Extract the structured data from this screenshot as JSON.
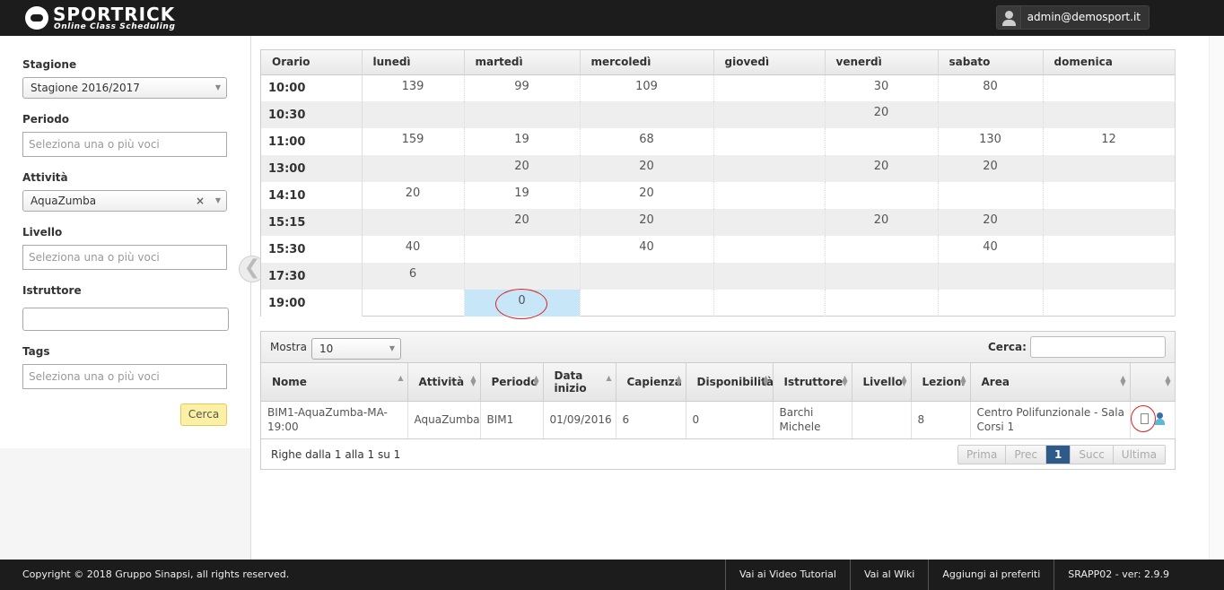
{
  "header": {
    "brand": "SPORTRICK",
    "tagline": "Online Class Scheduling",
    "user": "admin@demosport.it"
  },
  "sidebar": {
    "stagione": {
      "label": "Stagione",
      "value": "Stagione 2016/2017"
    },
    "periodo": {
      "label": "Periodo",
      "placeholder": "Seleziona una o più voci"
    },
    "attivita": {
      "label": "Attività",
      "value": "AquaZumba",
      "clear": "×"
    },
    "livello": {
      "label": "Livello",
      "placeholder": "Seleziona una o più voci"
    },
    "istruttore": {
      "label": "Istruttore",
      "value": ""
    },
    "tags": {
      "label": "Tags",
      "placeholder": "Seleziona una o più voci"
    },
    "search_button": "Cerca",
    "collapse_glyph": "❮"
  },
  "schedule": {
    "headers": [
      "Orario",
      "lunedì",
      "martedì",
      "mercoledì",
      "giovedì",
      "venerdì",
      "sabato",
      "domenica"
    ],
    "rows": [
      {
        "time": "10:00",
        "cells": [
          "139",
          "99",
          "109",
          "",
          "30",
          "80",
          ""
        ]
      },
      {
        "time": "10:30",
        "cells": [
          "",
          "",
          "",
          "",
          "20",
          "",
          ""
        ]
      },
      {
        "time": "11:00",
        "cells": [
          "159",
          "19",
          "68",
          "",
          "",
          "130",
          "12"
        ]
      },
      {
        "time": "13:00",
        "cells": [
          "",
          "20",
          "20",
          "",
          "20",
          "20",
          ""
        ]
      },
      {
        "time": "14:10",
        "cells": [
          "20",
          "19",
          "20",
          "",
          "",
          "",
          ""
        ]
      },
      {
        "time": "15:15",
        "cells": [
          "",
          "20",
          "20",
          "",
          "20",
          "20",
          ""
        ]
      },
      {
        "time": "15:30",
        "cells": [
          "40",
          "",
          "40",
          "",
          "",
          "40",
          ""
        ]
      },
      {
        "time": "17:30",
        "cells": [
          "6",
          "",
          "",
          "",
          "",
          "",
          ""
        ]
      },
      {
        "time": "19:00",
        "cells": [
          "",
          "0",
          "",
          "",
          "",
          "",
          ""
        ]
      }
    ]
  },
  "list": {
    "show_label": "Mostra",
    "show_value": "10",
    "search_label": "Cerca:",
    "columns": {
      "nome": "Nome",
      "attivita": "Attività",
      "periodo": "Periodo",
      "data_inizio": "Data inizio",
      "capienza": "Capienza",
      "disponibilita": "Disponibilità",
      "istruttore": "Istruttore",
      "livello": "Livello",
      "lezioni": "Lezioni",
      "area": "Area"
    },
    "rows": [
      {
        "nome": "BIM1-AquaZumba-MA-19:00",
        "attivita": "AquaZumba",
        "periodo": "BIM1",
        "data_inizio": "01/09/2016",
        "capienza": "6",
        "disponibilita": "0",
        "istruttore": "Barchi Michele",
        "livello": "",
        "lezioni": "8",
        "area": "Centro Polifunzionale - Sala Corsi 1"
      }
    ],
    "info": "Righe dalla 1 alla 1 su 1",
    "pager": {
      "first": "Prima",
      "prev": "Prec",
      "current": "1",
      "next": "Succ",
      "last": "Ultima"
    }
  },
  "footer": {
    "copyright": "Copyright © 2018 Gruppo Sinapsi, all rights reserved.",
    "links": [
      "Vai ai Video Tutorial",
      "Vai al Wiki",
      "Aggiungi ai preferiti",
      "SRAPP02 - ver: 2.9.9"
    ]
  },
  "colors": {
    "accent": "#2e5a8a",
    "selected_cell": "#c7e6f7",
    "highlight_ring": "#dd2222",
    "search_button": "#fcf0a4"
  }
}
